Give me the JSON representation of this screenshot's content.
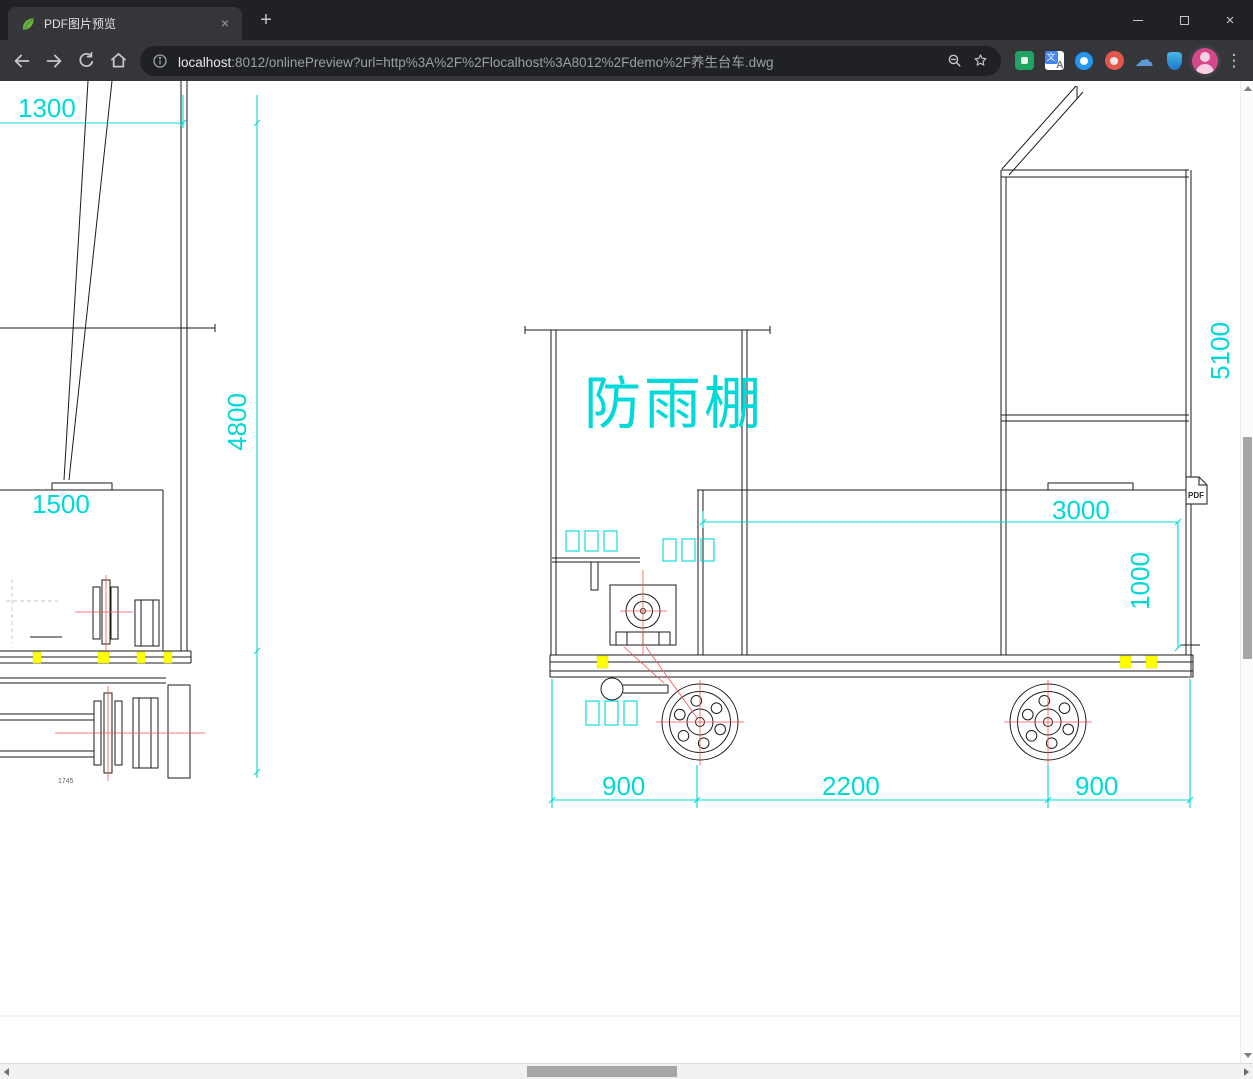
{
  "tab": {
    "title": "PDF图片预览",
    "close_glyph": "×"
  },
  "controls": {
    "new_tab_glyph": "+",
    "close_glyph": "×"
  },
  "urlbar": {
    "host": "localhost",
    "path": ":8012/onlinePreview?url=http%3A%2F%2Flocalhost%3A8012%2Fdemo%2F养生台车.dwg"
  },
  "icons": {
    "menu_glyph": "⋮",
    "cloud_glyph": "☁",
    "translate_cn": "文",
    "translate_a": "A"
  },
  "drawing": {
    "canopy": "防雨棚",
    "pdf_badge": "PDF",
    "dims": {
      "d1300": "1300",
      "d4800": "4800",
      "d1500": "1500",
      "d5100": "5100",
      "d3000": "3000",
      "d1000": "1000",
      "d900l": "900",
      "d2200": "2200",
      "d900r": "900",
      "note": "1745"
    }
  },
  "colors": {
    "dim_cyan": "#00d9d9",
    "center_red": "#ff5050",
    "mark_yellow": "#ffff00"
  }
}
